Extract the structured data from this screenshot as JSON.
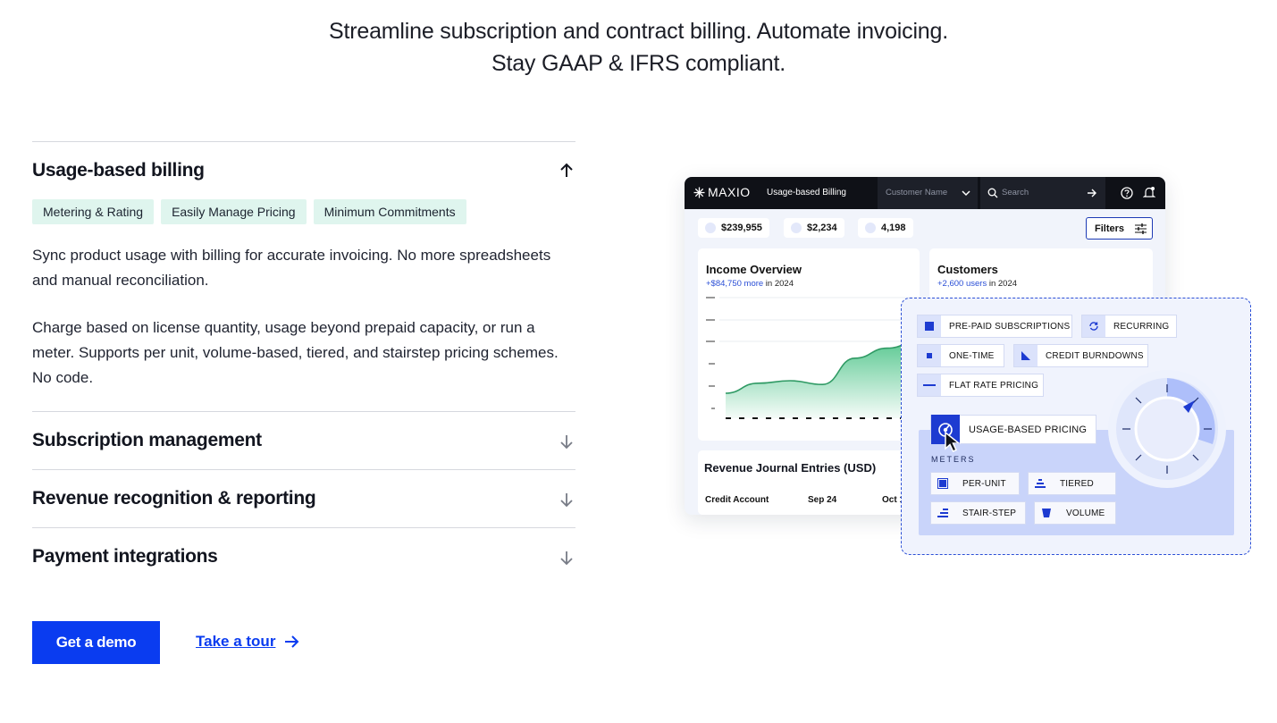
{
  "hero": {
    "line1": "Streamline subscription and contract billing. Automate invoicing.",
    "line2": "Stay GAAP & IFRS compliant."
  },
  "accordion": {
    "open": {
      "title": "Usage-based billing",
      "tags": [
        "Metering & Rating",
        "Easily Manage Pricing",
        "Minimum Commitments"
      ],
      "para1": "Sync product usage with billing for accurate invoicing. No more spreadsheets and manual reconciliation.",
      "para2": "Charge based on license quantity, usage beyond prepaid capacity, or run a meter. Supports per unit, volume-based, tiered, and stairstep pricing schemes. No code."
    },
    "closed": [
      {
        "title": "Subscription management"
      },
      {
        "title": "Revenue recognition & reporting"
      },
      {
        "title": "Payment integrations"
      }
    ]
  },
  "cta": {
    "demo": "Get a demo",
    "tour": "Take a tour"
  },
  "app": {
    "logo": "MAXIO",
    "title": "Usage-based Billing",
    "customer_placeholder": "Customer Name",
    "search_placeholder": "Search",
    "stats": [
      "$239,955",
      "$2,234",
      "4,198"
    ],
    "filters": "Filters",
    "income": {
      "title": "Income Overview",
      "highlight": "+$84,750 more",
      "suffix": " in 2024",
      "trend": [
        0.2,
        0.28,
        0.3,
        0.27,
        0.48,
        0.56,
        0.62
      ]
    },
    "customers": {
      "title": "Customers",
      "highlight": "+2,600 users",
      "suffix": " in 2024"
    },
    "revenue": {
      "title": "Revenue Journal Entries (USD)",
      "cols": [
        "Credit Account",
        "Sep 24",
        "Oct 1"
      ]
    }
  },
  "pricing": {
    "chips": [
      "PRE-PAID SUBSCRIPTIONS",
      "RECURRING",
      "ONE-TIME",
      "CREDIT BURNDOWNS",
      "FLAT RATE PRICING"
    ],
    "selected": "USAGE-BASED PRICING",
    "meters_label": "METERS",
    "meters": [
      "PER-UNIT",
      "TIERED",
      "STAIR-STEP",
      "VOLUME"
    ]
  },
  "colors": {
    "accent": "#0a3cf0",
    "tag_bg": "#dff5ee",
    "chart_green": "#3fbf7f"
  }
}
